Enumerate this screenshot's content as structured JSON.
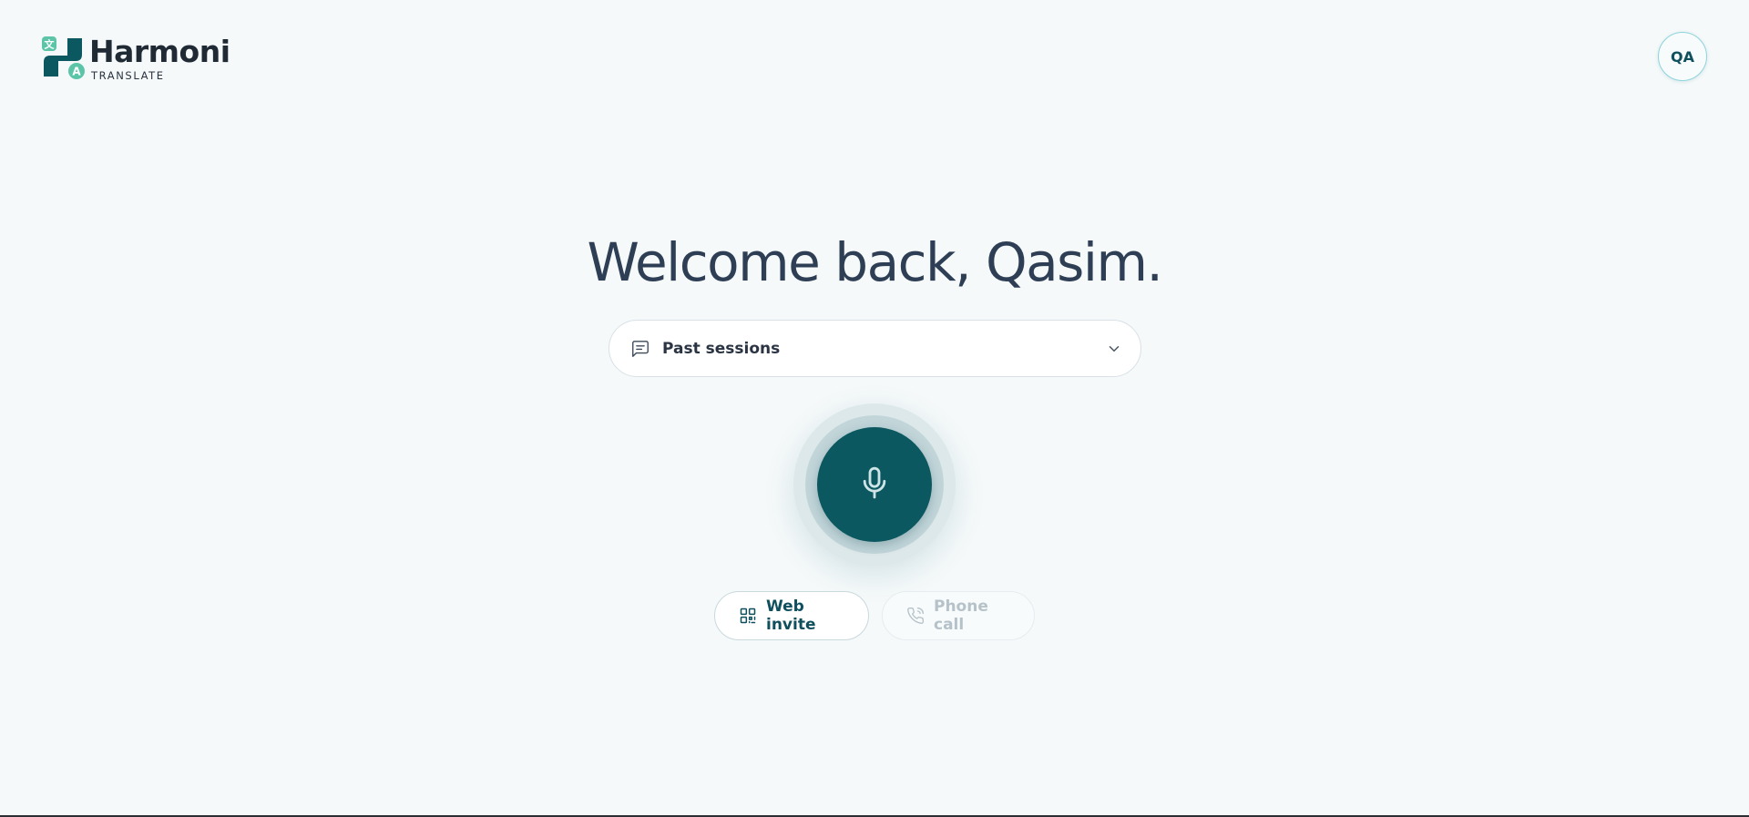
{
  "brand": {
    "name": "Harmoni",
    "sub": "TRANSLATE",
    "mark_glyph_top": "文",
    "mark_glyph_bottom": "A",
    "colors": {
      "primary": "#0c5860",
      "accent": "#5cc5a8",
      "text": "#1f2a35"
    }
  },
  "user": {
    "initials": "QA"
  },
  "main": {
    "greeting": "Welcome back, Qasim.",
    "sessions": {
      "label": "Past sessions",
      "icon": "message-square-text-icon",
      "chevron": "chevron-down-icon"
    },
    "mic": {
      "icon": "microphone-icon"
    },
    "actions": [
      {
        "label": "Web invite",
        "icon": "qr-code-icon",
        "enabled": true
      },
      {
        "label": "Phone call",
        "icon": "phone-call-icon",
        "enabled": false
      }
    ]
  }
}
